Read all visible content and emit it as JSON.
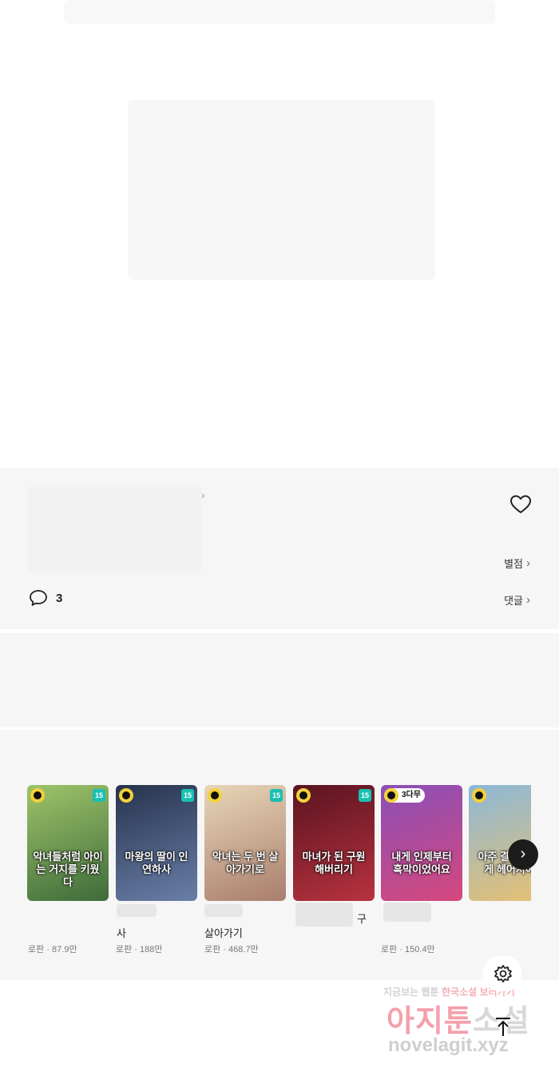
{
  "info": {
    "rating_link": "별점",
    "comment_link": "댓글",
    "comment_count": "3"
  },
  "recommendations": [
    {
      "cover_title": "악녀들처럼 아이는 거지를 키웠다",
      "badge": "15",
      "wait": "",
      "name": "",
      "genre": "로판",
      "views": "87.9만",
      "cover_colors": [
        "#9ec46a",
        "#3f6b3a"
      ]
    },
    {
      "cover_title": "마왕의 딸이 인연하사",
      "badge": "15",
      "wait": "",
      "name": "사",
      "genre": "로판",
      "views": "188만",
      "cover_colors": [
        "#26334d",
        "#6a7fa8"
      ]
    },
    {
      "cover_title": "악녀는 두 번 살아가기로",
      "badge": "15",
      "wait": "",
      "name": "살아가기",
      "genre": "로판",
      "views": "468.7만",
      "cover_colors": [
        "#e8d6b8",
        "#a97e6d"
      ]
    },
    {
      "cover_title": "마녀가 된 구원해버리기",
      "badge": "15",
      "wait": "",
      "name": "구",
      "genre": "",
      "views": "",
      "cover_colors": [
        "#5a1420",
        "#b8323f"
      ]
    },
    {
      "cover_title": "내게 인제부터 흑막이었어요",
      "badge": "",
      "wait": "3다무",
      "name": "",
      "genre": "로판",
      "views": "150.4만",
      "cover_colors": [
        "#8a4fb8",
        "#d6487c"
      ]
    },
    {
      "cover_title": "아주 결정 그렇게 헤어져야",
      "badge": "",
      "wait": "",
      "name": "",
      "genre": "",
      "views": "",
      "cover_colors": [
        "#8cb8d8",
        "#e8c070"
      ]
    }
  ],
  "watermark": {
    "line1_a": "지금보는",
    "line1_b": "웹툰",
    "line1_c": "한국소설",
    "line1_d": "보러가기",
    "line2_a": "아지툰",
    "line2_b": "소설",
    "line3": "novelagit.xyz"
  },
  "icons": {
    "heart": "heart-outline-icon",
    "comment": "speech-bubble-icon",
    "next": "chevron-right-icon",
    "settings": "gear-icon",
    "top": "arrow-up-to-top-icon"
  }
}
